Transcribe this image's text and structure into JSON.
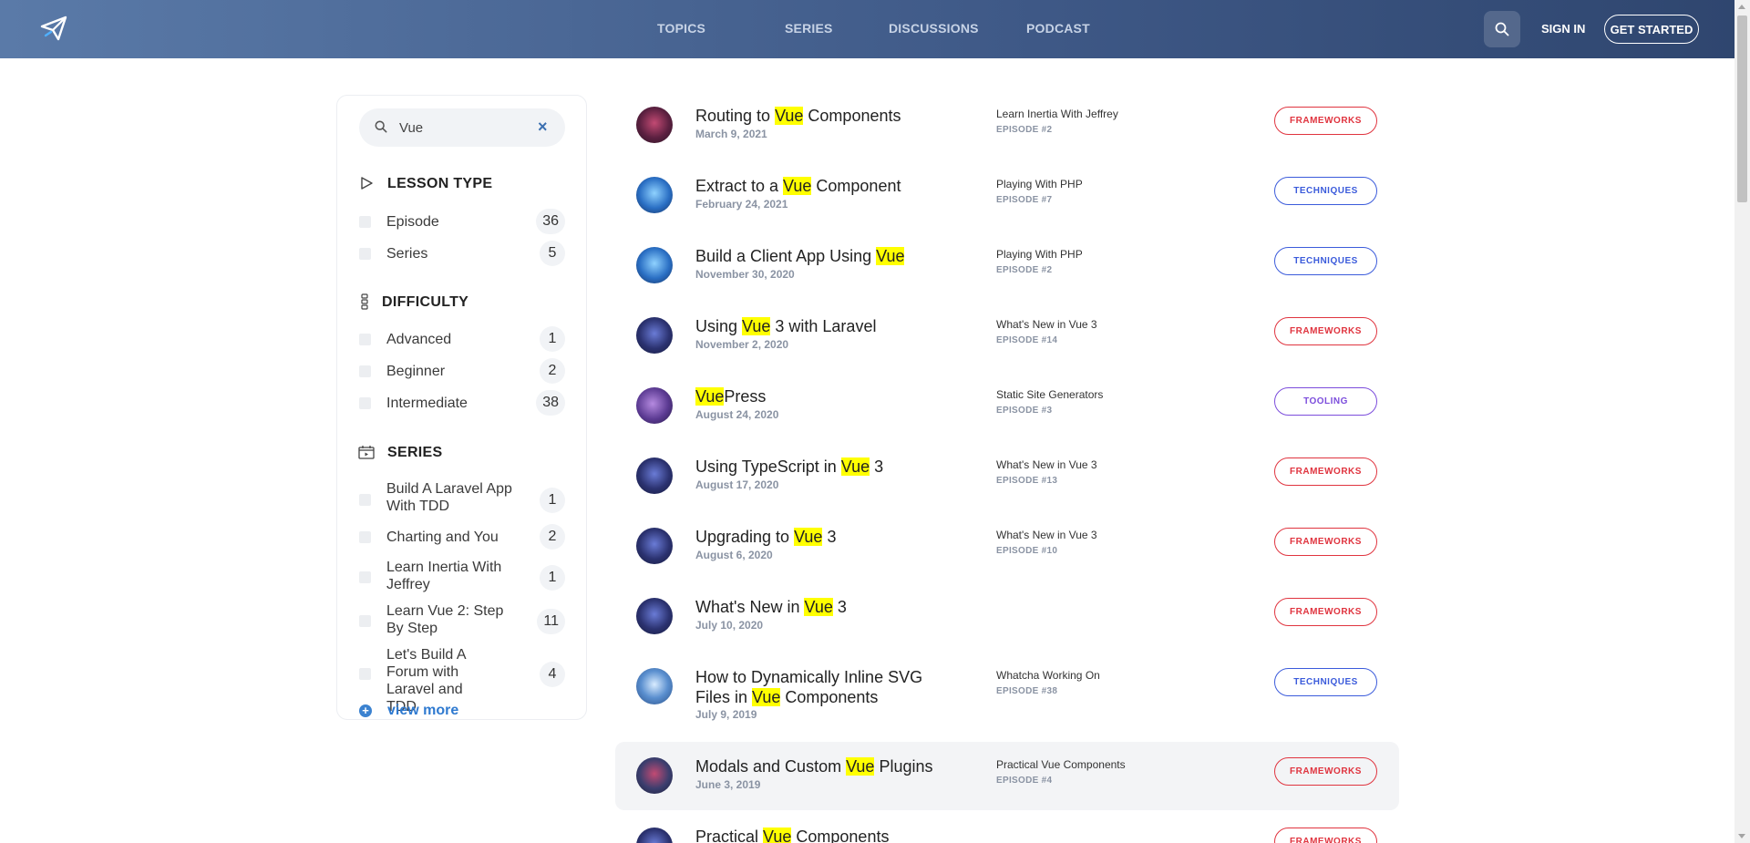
{
  "header": {
    "nav": [
      "TOPICS",
      "SERIES",
      "DISCUSSIONS",
      "PODCAST"
    ],
    "sign_in": "SIGN IN",
    "get_started": "GET STARTED"
  },
  "sidebar": {
    "search_value": "Vue",
    "clear_label": "×",
    "lesson_type": {
      "title": "LESSON TYPE",
      "items": [
        {
          "label": "Episode",
          "count": "36"
        },
        {
          "label": "Series",
          "count": "5"
        }
      ]
    },
    "difficulty": {
      "title": "DIFFICULTY",
      "items": [
        {
          "label": "Advanced",
          "count": "1"
        },
        {
          "label": "Beginner",
          "count": "2"
        },
        {
          "label": "Intermediate",
          "count": "38"
        }
      ]
    },
    "series": {
      "title": "SERIES",
      "items": [
        {
          "label": "Build A Laravel App With TDD",
          "count": "1"
        },
        {
          "label": "Charting and You",
          "count": "2"
        },
        {
          "label": "Learn Inertia With Jeffrey",
          "count": "1"
        },
        {
          "label": "Learn Vue 2: Step By Step",
          "count": "11"
        },
        {
          "label": "Let's Build A Forum with Laravel and TDD",
          "count": "4"
        }
      ]
    },
    "view_more": "view more"
  },
  "lessons": [
    {
      "pre": "Routing to ",
      "hl": "Vue",
      "post": " Components",
      "date": "March 9, 2021",
      "series": "Learn Inertia With Jeffrey",
      "episode": "EPISODE #2",
      "tag": "FRAMEWORKS"
    },
    {
      "pre": "Extract to a ",
      "hl": "Vue",
      "post": " Component",
      "date": "February 24, 2021",
      "series": "Playing With PHP",
      "episode": "EPISODE #7",
      "tag": "TECHNIQUES"
    },
    {
      "pre": "Build a Client App Using ",
      "hl": "Vue",
      "post": "",
      "date": "November 30, 2020",
      "series": "Playing With PHP",
      "episode": "EPISODE #2",
      "tag": "TECHNIQUES"
    },
    {
      "pre": "Using ",
      "hl": "Vue",
      "post": " 3 with Laravel",
      "date": "November 2, 2020",
      "series": "What's New in Vue 3",
      "episode": "EPISODE #14",
      "tag": "FRAMEWORKS"
    },
    {
      "pre": "",
      "hl": "Vue",
      "post": "Press",
      "date": "August 24, 2020",
      "series": "Static Site Generators",
      "episode": "EPISODE #3",
      "tag": "TOOLING"
    },
    {
      "pre": "Using TypeScript in ",
      "hl": "Vue",
      "post": " 3",
      "date": "August 17, 2020",
      "series": "What's New in Vue 3",
      "episode": "EPISODE #13",
      "tag": "FRAMEWORKS"
    },
    {
      "pre": "Upgrading to ",
      "hl": "Vue",
      "post": " 3",
      "date": "August 6, 2020",
      "series": "What's New in Vue 3",
      "episode": "EPISODE #10",
      "tag": "FRAMEWORKS"
    },
    {
      "pre": "What's New in ",
      "hl": "Vue",
      "post": " 3",
      "date": "July 10, 2020",
      "series": "",
      "episode": "",
      "tag": "FRAMEWORKS"
    },
    {
      "pre": "How to Dynamically Inline SVG Files in ",
      "hl": "Vue",
      "post": " Components",
      "date": "July 9, 2019",
      "series": "Whatcha Working On",
      "episode": "EPISODE #38",
      "tag": "TECHNIQUES"
    },
    {
      "pre": "Modals and Custom ",
      "hl": "Vue",
      "post": " Plugins",
      "date": "June 3, 2019",
      "series": "Practical Vue Components",
      "episode": "EPISODE #4",
      "tag": "FRAMEWORKS"
    },
    {
      "pre": "Practical ",
      "hl": "Vue",
      "post": " Components",
      "date": "",
      "series": "",
      "episode": "",
      "tag": "FRAMEWORKS"
    }
  ],
  "colors": {
    "frameworks": "#e0343f",
    "techniques": "#3b5bdb",
    "tooling": "#7c4ddc",
    "highlight": "#ffff00"
  }
}
